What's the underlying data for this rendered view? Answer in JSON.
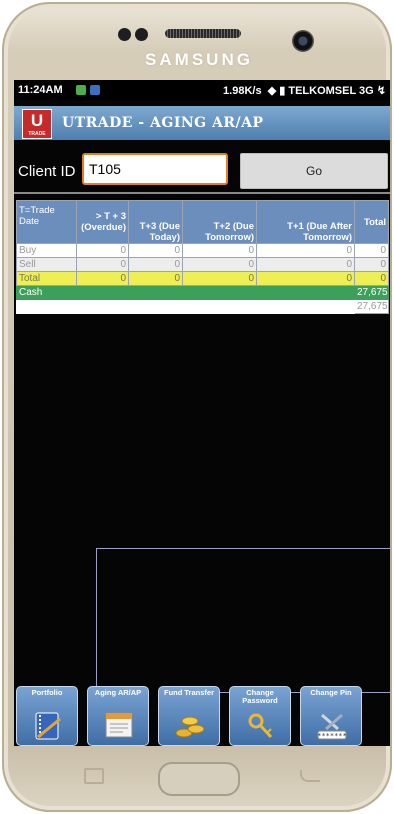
{
  "device": {
    "brand": "SAMSUNG"
  },
  "status_bar": {
    "time": "11:24AM",
    "speed": "1.98K/s",
    "carrier": "TELKOMSEL 3G",
    "icons": [
      "notification-green-icon",
      "notification-blue-icon",
      "wifi-icon",
      "signal-icon",
      "charging-icon"
    ]
  },
  "header": {
    "logo_letter": "U",
    "logo_sub": "TRADE",
    "title": "UTRADE  -  AGING AR/AP"
  },
  "client": {
    "label": "Client ID",
    "value": "T105",
    "go_label": "Go"
  },
  "table": {
    "headers": [
      "T=Trade Date",
      "> T + 3 (Overdue)",
      "T+3 (Due Today)",
      "T+2 (Due Tomorrow)",
      "T+1 (Due After Tomorrow)",
      "Total"
    ],
    "rows": [
      {
        "label": "Buy",
        "values": [
          "0",
          "0",
          "0",
          "0",
          "0"
        ]
      },
      {
        "label": "Sell",
        "values": [
          "0",
          "0",
          "0",
          "0",
          "0"
        ]
      },
      {
        "label": "Total",
        "values": [
          "0",
          "0",
          "0",
          "0",
          "0"
        ]
      }
    ],
    "cash": {
      "label": "Cash",
      "value": "27,675"
    },
    "grand_total": "27,675"
  },
  "nav": [
    {
      "label": "Portfolio",
      "icon": "notebook-icon"
    },
    {
      "label": "Aging AR/AP",
      "icon": "document-icon"
    },
    {
      "label": "Fund Transfer",
      "icon": "coins-icon"
    },
    {
      "label": "Change Password",
      "icon": "keys-icon"
    },
    {
      "label": "Change Pin",
      "icon": "tools-pin-icon"
    }
  ],
  "colors": {
    "title_bar": "#4f7fb0",
    "total_row": "#eeee55",
    "cash_row": "#3da05a",
    "input_border": "#e27e24"
  }
}
